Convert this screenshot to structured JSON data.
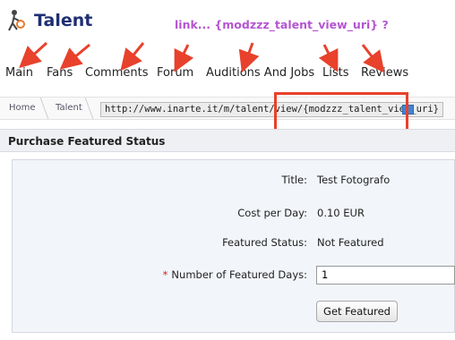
{
  "header": {
    "title": "Talent",
    "annotation": "link... {modzzz_talent_view_uri} ?",
    "accent_color": "#1f2f73",
    "annotation_color": "#b455d1"
  },
  "tabs": [
    {
      "label": "Main"
    },
    {
      "label": "Fans"
    },
    {
      "label": "Comments"
    },
    {
      "label": "Forum"
    },
    {
      "label": "Auditions And Jobs"
    },
    {
      "label": "Lists"
    },
    {
      "label": "Reviews"
    }
  ],
  "breadcrumb": {
    "home": "Home",
    "current": "Talent"
  },
  "url_tooltip": {
    "text": "http://www.inarte.it/m/talent/view/{modzzz_talent_view_uri}",
    "highlight_color": "#e8412c"
  },
  "section": {
    "title": "Purchase Featured Status"
  },
  "form": {
    "title_label": "Title:",
    "title_value": "Test Fotografo",
    "cost_label": "Cost per Day:",
    "cost_value": "0.10 EUR",
    "status_label": "Featured Status:",
    "status_value": "Not Featured",
    "required_mark": "*",
    "days_label": "Number of Featured Days:",
    "days_value": "1",
    "submit_label": "Get Featured"
  },
  "icons": {
    "logo": "talent-figure-icon",
    "arrow": "red-arrow-icon"
  }
}
